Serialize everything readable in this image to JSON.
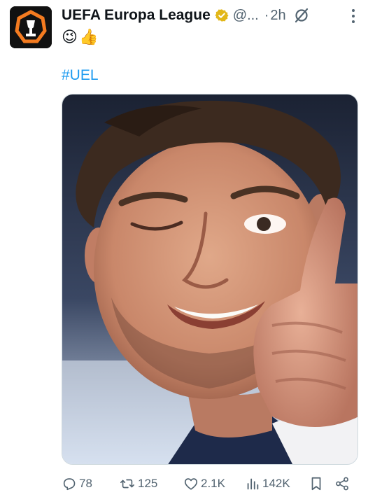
{
  "tweet": {
    "display_name": "UEFA Europa League",
    "handle": "@...",
    "separator": "·",
    "time": "2h",
    "text_emojis": [
      "😉",
      "👍"
    ],
    "hashtag": "#UEL",
    "media_icon": "photo-of-player-winking-thumbs-up",
    "stats": {
      "replies": "78",
      "reposts": "125",
      "likes": "2.1K",
      "views": "142K"
    },
    "icons": {
      "verified": "verified-gold-badge-icon",
      "grok": "grok-icon",
      "more": "more-options-icon",
      "reply": "reply-icon",
      "repost": "repost-icon",
      "like": "heart-icon",
      "views": "views-chart-icon",
      "bookmark": "bookmark-icon",
      "share": "share-icon"
    },
    "colors": {
      "accent": "#1d9bf0",
      "verified_gold": "#e2b719",
      "muted": "#536471",
      "avatar_bg": "#111111"
    }
  }
}
